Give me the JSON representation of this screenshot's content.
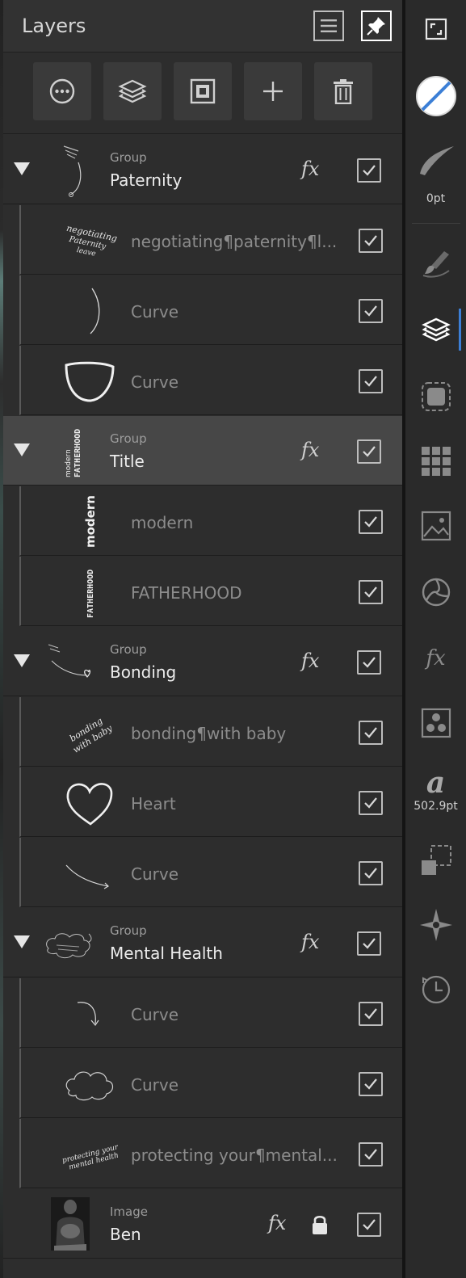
{
  "panel": {
    "title": "Layers"
  },
  "layers": [
    {
      "kind": "Group",
      "name": "Paternity",
      "thumb_text": ""
    },
    {
      "kind": "",
      "name": "negotiating¶paternity¶l...",
      "thumb_text": "negotiating paternity leave"
    },
    {
      "kind": "",
      "name": "Curve"
    },
    {
      "kind": "",
      "name": "Curve"
    },
    {
      "kind": "Group",
      "name": "Title",
      "thumb_text": "modern FATHERHOOD"
    },
    {
      "kind": "",
      "name": "modern",
      "thumb_text": "modern"
    },
    {
      "kind": "",
      "name": "FATHERHOOD",
      "thumb_text": "FATHERHOOD"
    },
    {
      "kind": "Group",
      "name": "Bonding"
    },
    {
      "kind": "",
      "name": "bonding¶with baby",
      "thumb_text": "bonding with baby"
    },
    {
      "kind": "",
      "name": "Heart"
    },
    {
      "kind": "",
      "name": "Curve"
    },
    {
      "kind": "Group",
      "name": "Mental Health"
    },
    {
      "kind": "",
      "name": "Curve"
    },
    {
      "kind": "",
      "name": "Curve"
    },
    {
      "kind": "",
      "name": "protecting your¶mental...",
      "thumb_text": "protecting your mental health"
    },
    {
      "kind": "Image",
      "name": "Ben"
    }
  ],
  "fx_label": "fx",
  "toolbar": {
    "stroke_width": "0pt",
    "font_size": "502.9pt",
    "fx_label": "fx",
    "font_glyph": "a"
  },
  "colors": {
    "accent": "#3c7fd6",
    "panel_bg": "#2d2d2d",
    "selected_row": "#474747"
  }
}
